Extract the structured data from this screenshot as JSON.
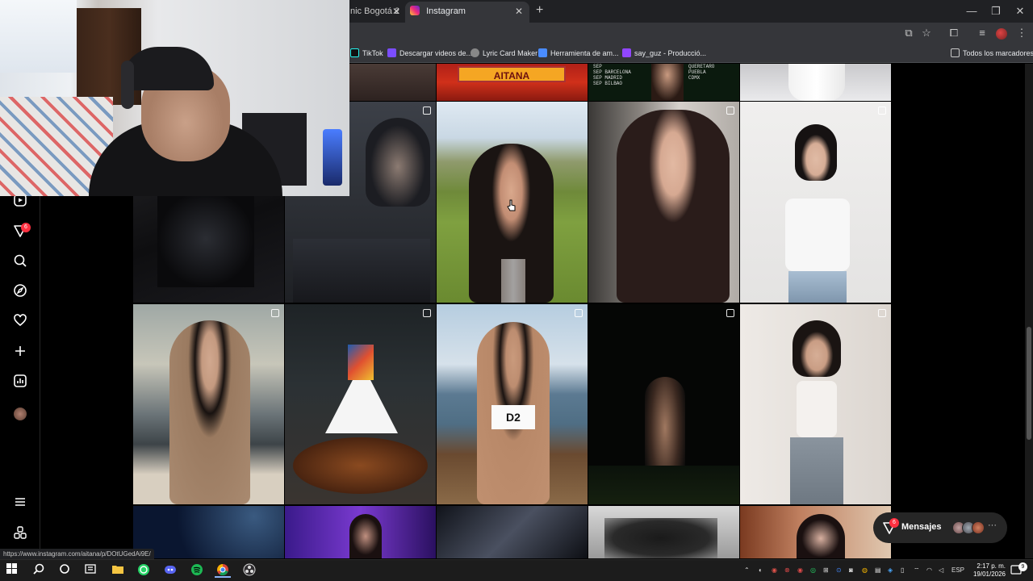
{
  "browser": {
    "tabs": [
      {
        "label": "nic Bogotá 2",
        "active": false
      },
      {
        "label": "Instagram",
        "active": true
      }
    ],
    "new_tab_symbol": "+",
    "window_controls": [
      "—",
      "❐",
      "✕"
    ],
    "bookmarks": [
      {
        "label": "TikTok",
        "icon": "tiktok-icon"
      },
      {
        "label": "Descargar videos de...",
        "icon": "download-icon"
      },
      {
        "label": "Lyric Card Maker",
        "icon": "globe-icon"
      },
      {
        "label": "Herramienta de am...",
        "icon": "heart-icon"
      },
      {
        "label": "say_guz - Producció...",
        "icon": "twitch-icon"
      }
    ],
    "all_bookmarks": "Todos los marcadores",
    "status_url": "https://www.instagram.com/aitana/p/DOtUGedAi9E/"
  },
  "instagram": {
    "nav": [
      {
        "name": "reels",
        "icon": "reels-icon"
      },
      {
        "name": "messages",
        "icon": "messenger-icon",
        "badge": "6"
      },
      {
        "name": "search",
        "icon": "search-icon"
      },
      {
        "name": "explore",
        "icon": "compass-icon"
      },
      {
        "name": "notifications",
        "icon": "heart-icon"
      },
      {
        "name": "create",
        "icon": "plus-icon"
      },
      {
        "name": "dashboard",
        "icon": "chart-icon"
      },
      {
        "name": "profile",
        "icon": "avatar"
      },
      {
        "name": "more",
        "icon": "menu-icon"
      },
      {
        "name": "also-from-meta",
        "icon": "apps-icon"
      }
    ],
    "grid": {
      "top_card_label": "AITANA",
      "poster_lines": [
        "SEP",
        "SEP  BARCELONA",
        "SEP  MADRID",
        "SEP  BILBAO"
      ],
      "poster_lines_right": [
        "",
        "QUERETARO",
        "PUEBLA",
        "CDMX"
      ],
      "swimsuit_text": "D2"
    },
    "messages": {
      "label": "Mensajes",
      "badge": "6"
    }
  },
  "taskbar": {
    "apps": [
      "windows-icon",
      "search-icon",
      "task-view-icon",
      "widgets-icon",
      "file-explorer-icon",
      "whatsapp-icon",
      "discord-icon",
      "spotify-icon",
      "chrome-icon",
      "obs-icon"
    ],
    "language": "ESP",
    "time": "2:17 p. m.",
    "date": "19/01/2026",
    "notification_count": "9"
  },
  "colors": {
    "ig_badge": "#ff3040",
    "chrome_dark": "#202124",
    "toolbar": "#35363a",
    "aitana_card": "#f5a623"
  }
}
